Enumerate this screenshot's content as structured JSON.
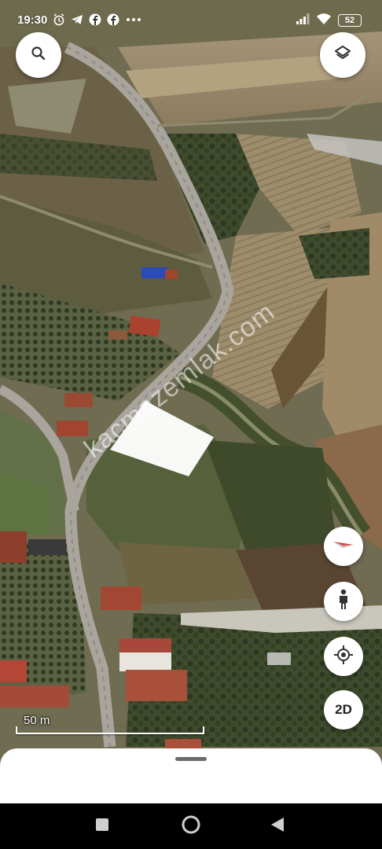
{
  "status_bar": {
    "time": "19:30",
    "notification_icons": [
      "alarm-icon",
      "telegram-icon",
      "facebook-icon",
      "facebook-icon",
      "more-dots-icon"
    ],
    "battery": "52",
    "right_icons": [
      "signal-icon",
      "wifi-icon",
      "battery-icon"
    ]
  },
  "map": {
    "view": "satellite-3d",
    "watermark": "kacmazemlak.com",
    "highlight_color": "#ffffff"
  },
  "controls": {
    "search_icon": "search-icon",
    "layers_icon": "layers-icon",
    "compass_icon": "compass-icon",
    "street_view_icon": "pegman-icon",
    "my_location_icon": "my-location-icon",
    "mode_toggle_label": "2D"
  },
  "scale_bar": {
    "label": "50 m"
  },
  "bottom_sheet": {
    "handle": "drag-handle"
  },
  "nav_bar": {
    "buttons": [
      "recents-square-icon",
      "home-circle-icon",
      "back-triangle-icon"
    ]
  },
  "colors": {
    "accent_compass_red": "#e53935",
    "sheet_bg": "#ffffff"
  }
}
